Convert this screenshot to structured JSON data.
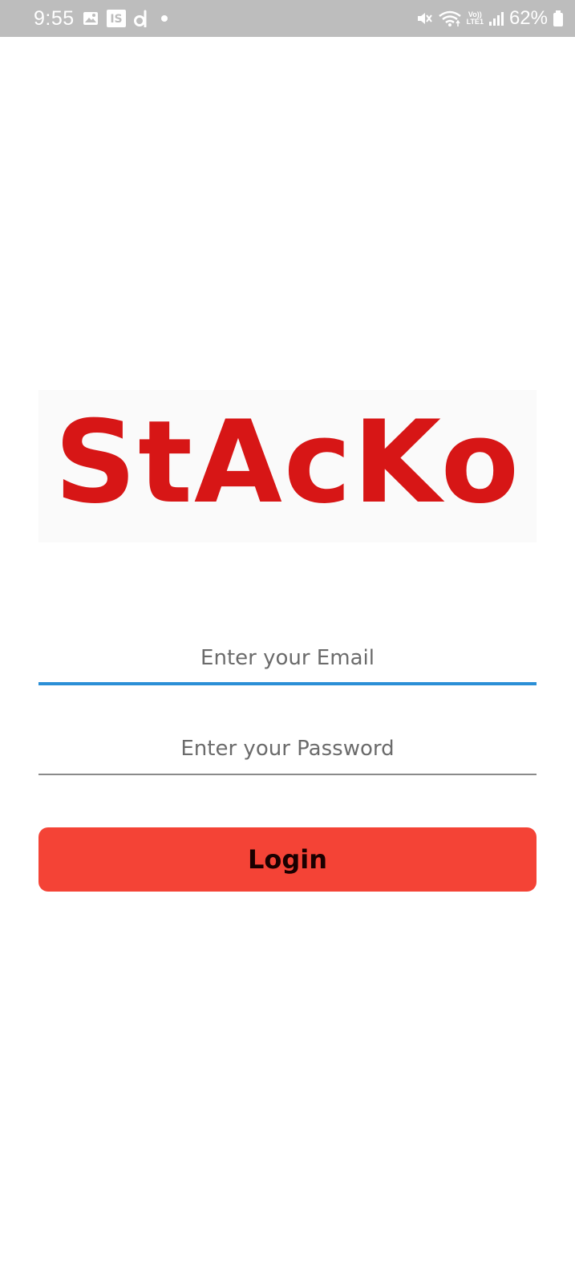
{
  "status_bar": {
    "time": "9:55",
    "volte_line1": "Vo))",
    "volte_line2": "LTE1",
    "battery_percent": "62%",
    "notification_icons": [
      "gallery-icon",
      "app-is-icon",
      "app-d-icon",
      "dot-icon"
    ],
    "system_icons": [
      "mute-vibrate-icon",
      "wifi-icon",
      "volte-icon",
      "signal-icon",
      "battery-icon"
    ]
  },
  "logo": {
    "text": "StAcKo",
    "color": "#d71616"
  },
  "form": {
    "email_placeholder": "Enter your Email",
    "email_value": "",
    "password_placeholder": "Enter your Password",
    "password_value": "",
    "login_label": "Login",
    "accent_color": "#2b8fd6",
    "button_color": "#f44336"
  }
}
